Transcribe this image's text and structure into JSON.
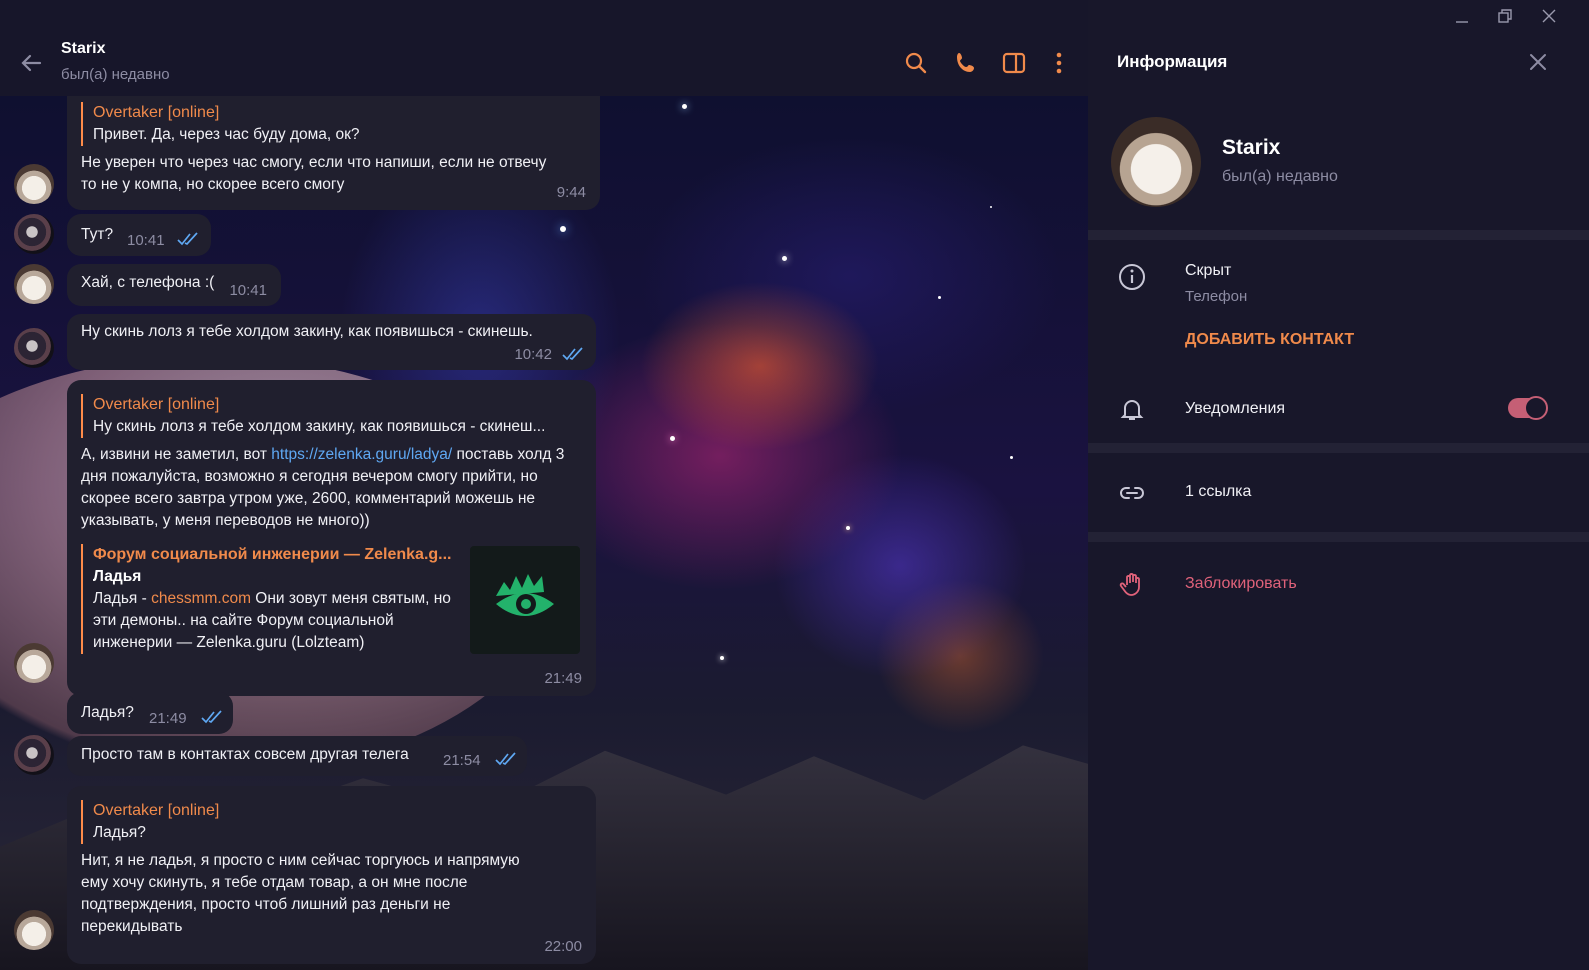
{
  "header": {
    "title": "Starix",
    "status": "был(а) недавно"
  },
  "messages": [
    {
      "reply_name": "Overtaker [online]",
      "reply_text": "Привет. Да, через час буду дома, ок?",
      "text": "Не уверен что через час смогу, если что напиши, если не отвечу то не у компа, но скорее всего смогу",
      "time": "9:44"
    },
    {
      "text": "Тут?",
      "time": "10:41"
    },
    {
      "text": "Хай, с телефона :(",
      "time": "10:41"
    },
    {
      "text": "Ну скинь лолз  я тебе холдом закину, как появишься - скинешь.",
      "time": "10:42"
    },
    {
      "reply_name": "Overtaker [online]",
      "reply_text": "Ну скинь лолз  я тебе холдом закину, как появишься - скинеш...",
      "text_before_link": "А, извини не заметил, вот ",
      "link": "https://zelenka.guru/ladya/",
      "text_after_link": " поставь холд 3 дня пожалуйста, возможно я сегодня вечером смогу прийти, но скорее всего завтра утром уже, 2600, комментарий можешь не указывать, у меня переводов не много))",
      "preview_site": "Форум социальной инженерии — Zelenka.g...",
      "preview_title": "Ладья",
      "preview_desc_before": "Ладья - ",
      "preview_desc_link": "chessmm.com",
      "preview_desc_after": " Они зовут меня святым, но эти демоны.. на сайте Форум социальной инженерии — Zelenka.guru (Lolzteam)",
      "time": "21:49"
    },
    {
      "text": "Ладья?",
      "time": "21:49"
    },
    {
      "text": "Просто там в контактах совсем другая телега",
      "time": "21:54"
    },
    {
      "reply_name": "Overtaker [online]",
      "reply_text": "Ладья?",
      "text": "Нит, я не ладья, я просто с ним сейчас торгуюсь и напрямую ему хочу скинуть, я тебе отдам товар, а он мне после подтверждения, просто чтоб лишний раз деньги не перекидывать",
      "time": "22:00"
    }
  ],
  "panel": {
    "title": "Информация",
    "name": "Starix",
    "status": "был(а) недавно",
    "phone_value": "Скрыт",
    "phone_label": "Телефон",
    "add_contact": "ДОБАВИТЬ КОНТАКТ",
    "notifications": "Уведомления",
    "notifications_on": true,
    "links": "1 ссылка",
    "block": "Заблокировать"
  }
}
